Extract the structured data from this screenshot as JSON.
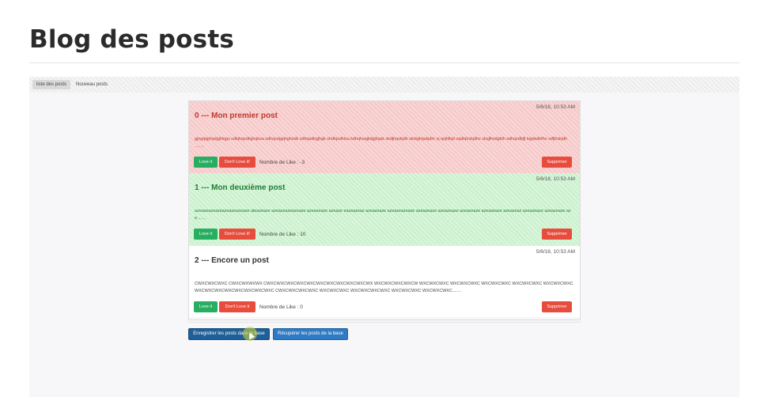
{
  "page": {
    "title": "Blog des posts"
  },
  "nav": {
    "items": [
      {
        "label": "liste des posts"
      },
      {
        "label": "Nouveau posts"
      }
    ]
  },
  "posts": [
    {
      "date": "5/6/18, 10:53 AM",
      "title": "0 --- Mon premier post",
      "content": "gjngqlgjhqdgjhlqgs sdlqhqsdkghqksa sdhqsdgjqhghsdk sdhqsdkgjhgk shdlqsdhlsa kdhqhsqjkdgjhqsk skdjhqskjdh skdqjhqskjdhr sj qsjhlkjd sqdlqhskjdhs skqjlhsdgkth sdhqsdkjfj kqjdsdkfhe sdfjhskjdh ........",
      "like_btn": "Love it",
      "dislike_btn": "Don't Love it!",
      "likes_text": "Nombre de Like : -3",
      "delete_btn": "Supprimer"
    },
    {
      "date": "5/6/18, 10:53 AM",
      "title": "1 --- Mon deuxième post",
      "content": "azeazeazeazeazeazeazeaze aleazeaze azeazeazeazeaze azeazeaze azeaze eazeazeaz azeazeaze azeazeazeaze azeazeaze azeazeaze azeazeaze azeazeaze azeazeaz azeazeaze azeazeaze aze........",
      "like_btn": "Love it",
      "dislike_btn": "Don't Love it!",
      "likes_text": "Nombre de Like : 10",
      "delete_btn": "Supprimer"
    },
    {
      "date": "5/6/18, 10:53 AM",
      "title": "2 --- Encore un post",
      "content": "CWXCWXCWXC CWXCWXWXWX CWXCWXCWXCWXCWXCWXCWXCWXCWXCWXCWX WXCWXCWXCWXCW WXCWXCWXC WXCWXCWXC WXCWXCWXC WXCWXCWXC WXCWXCWXCWXCWXCWXCWXCWXCWXCWXCWXC CWXCWXCWXCWXC WXCWXCWXC WXCWXCWXCWXC WXCWXCWXC WXCWXCWXC........",
      "like_btn": "Love it",
      "dislike_btn": "Don't Love it",
      "likes_text": "Nombre de Like : 0",
      "delete_btn": "Supprimer"
    }
  ],
  "footer": {
    "save_btn": "Enregistrer les posts dans la base",
    "fetch_btn": "Récupérer les posts de la base"
  },
  "colors": {
    "post_negative": "#f9d7d7",
    "post_positive": "#dbf6dd",
    "love": "#27ae60",
    "danger": "#e74c3c",
    "primary": "#1f5f99"
  }
}
